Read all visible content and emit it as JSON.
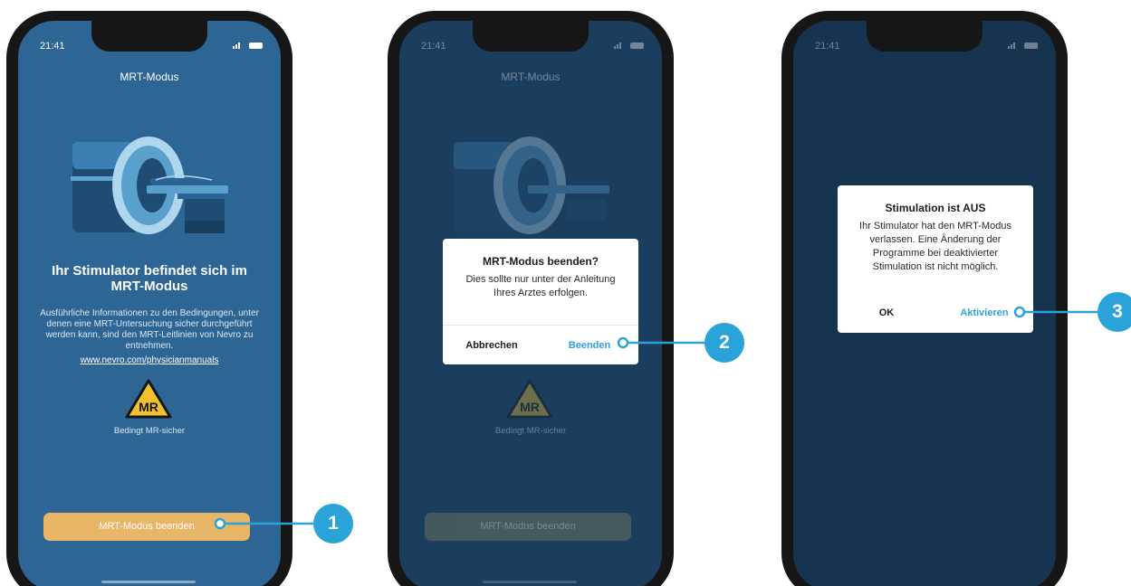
{
  "phones": [
    {
      "time": "21:41",
      "title": "MRT-Modus",
      "heading": "Ihr Stimulator befindet sich im MRT-Modus",
      "body": "Ausführliche Informationen zu den Bedingungen, unter denen eine MRT-Untersuchung sicher durchgeführt werden kann, sind den MRT-Leitlinien von Nevro zu entnehmen.",
      "link": "www.nevro.com/physicianmanuals",
      "badge": "MR",
      "badge_caption": "Bedingt MR-sicher",
      "button": "MRT-Modus beenden"
    },
    {
      "time": "21:41",
      "title": "MRT-Modus",
      "badge": "MR",
      "badge_caption": "Bedingt MR-sicher",
      "button": "MRT-Modus beenden",
      "dialog": {
        "title": "MRT-Modus beenden?",
        "text": "Dies sollte nur unter der Anleitung Ihres Arztes erfolgen.",
        "cancel": "Abbrechen",
        "confirm": "Beenden"
      }
    },
    {
      "time": "21:41",
      "dialog": {
        "title": "Stimulation ist AUS",
        "text": "Ihr Stimulator hat den MRT-Modus verlassen. Eine Änderung der Programme bei deaktivierter Stimulation ist nicht möglich.",
        "ok": "OK",
        "activate": "Aktivieren"
      }
    }
  ],
  "callouts": [
    "1",
    "2",
    "3"
  ],
  "colors": {
    "screen_blue": "#2d6594",
    "screen_dark": "#1b3d5e",
    "accent": "#2aa3d8",
    "button_orange": "#e8b666",
    "badge_yellow": "#f2c12e"
  }
}
